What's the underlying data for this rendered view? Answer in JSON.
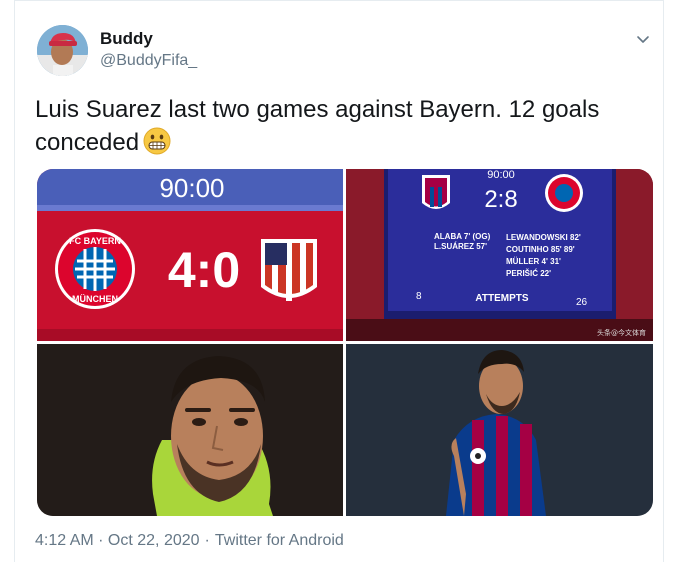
{
  "tweet": {
    "display_name": "Buddy",
    "handle": "@BuddyFifa_",
    "text": "Luis Suarez last two games against Bayern. 12 goals conceded",
    "emoji": "grimacing-face-emoji",
    "timestamp": "4:12 AM · Oct 22, 2020",
    "separator": "·",
    "source": "Twitter for Android"
  },
  "media": {
    "scoreboard1": {
      "clock": "90:00",
      "score": "4:0",
      "home_badge_text_top": "FC BAYERN",
      "home_badge_text_bottom": "MÜNCHEN"
    },
    "scoreboard2": {
      "clock": "90:00",
      "score": "2:8",
      "home_scorers": [
        "ALABA 7' (OG)",
        "L.SUÁREZ 57'"
      ],
      "away_scorers": [
        "LEWANDOWSKI 82'",
        "COUTINHO 85' 89'",
        "MÜLLER 4' 31'",
        "PERIŠIĆ 22'"
      ],
      "attempts_label": "ATTEMPTS",
      "home_attempts": "8",
      "away_attempts": "26",
      "watermark": "头条@今文体育"
    }
  },
  "colors": {
    "text": "#14171a",
    "muted": "#657786",
    "border": "#e6ecf0",
    "bayern_red": "#dc052d",
    "scoreboard_blue": "#2b2d9b"
  }
}
